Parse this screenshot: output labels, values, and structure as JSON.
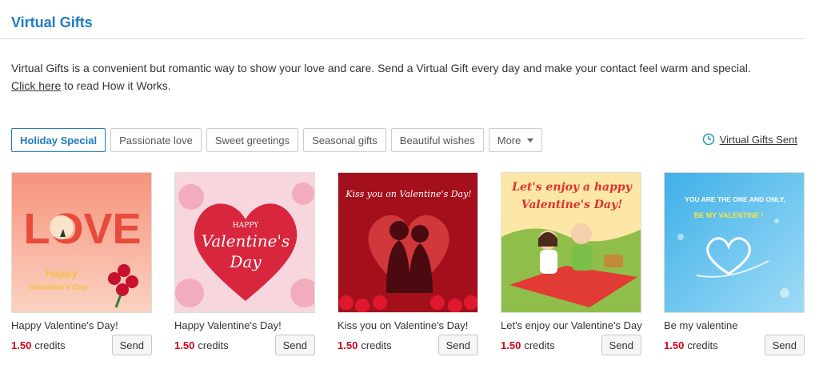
{
  "header": {
    "title": "Virtual Gifts"
  },
  "intro": {
    "text": "Virtual Gifts is a convenient but romantic way to show your love and care. Send a Virtual Gift every day and make your contact feel warm and special.",
    "link_label": "Click here",
    "link_suffix": " to read How it Works."
  },
  "tabs": [
    {
      "label": "Holiday Special",
      "active": true
    },
    {
      "label": "Passionate love"
    },
    {
      "label": "Sweet greetings"
    },
    {
      "label": "Seasonal gifts"
    },
    {
      "label": "Beautiful wishes"
    },
    {
      "label": "More"
    }
  ],
  "sent_link": {
    "label": "Virtual Gifts Sent",
    "icon": "clock-icon"
  },
  "gifts": [
    {
      "name": "Happy Valentine's Day!",
      "price": "1.50",
      "unit": "credits",
      "send_label": "Send",
      "art": {
        "lines": [
          "LOVE",
          "Happy",
          "Valentine's Day"
        ]
      }
    },
    {
      "name": "Happy Valentine's Day!",
      "price": "1.50",
      "unit": "credits",
      "send_label": "Send",
      "art": {
        "lines": [
          "HAPPY",
          "Valentine's",
          "Day"
        ]
      }
    },
    {
      "name": "Kiss you on Valentine's Day!",
      "price": "1.50",
      "unit": "credits",
      "send_label": "Send",
      "art": {
        "lines": [
          "Kiss you on Valentine's Day!"
        ]
      }
    },
    {
      "name": "Let's enjoy our Valentine's Day",
      "price": "1.50",
      "unit": "credits",
      "send_label": "Send",
      "art": {
        "lines": [
          "Let's enjoy a happy",
          "Valentine's Day!"
        ]
      }
    },
    {
      "name": "Be my valentine",
      "price": "1.50",
      "unit": "credits",
      "send_label": "Send",
      "art": {
        "lines": [
          "YOU ARE THE ONE AND ONLY,",
          "BE MY VALENTINE !"
        ]
      }
    }
  ]
}
